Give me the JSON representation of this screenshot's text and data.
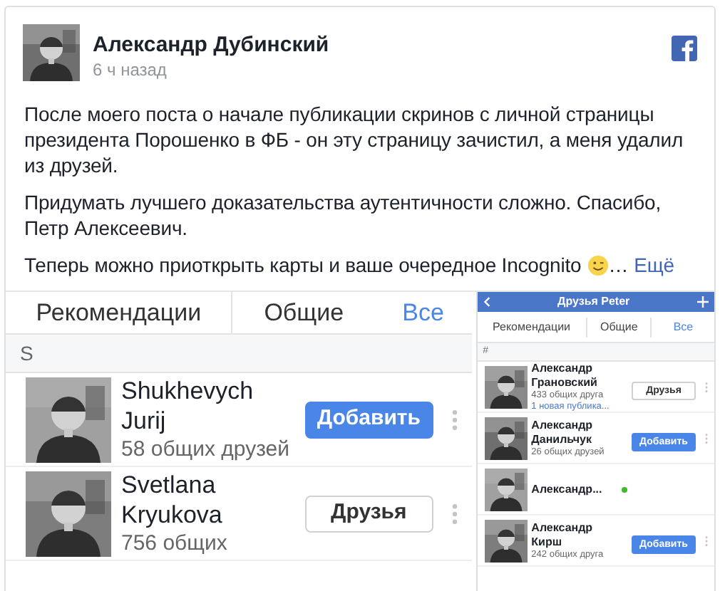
{
  "post": {
    "author": "Александр Дубинский",
    "time": "6 ч назад",
    "paragraphs": [
      "После моего поста о начале публикации скринов с личной страницы президента Порошенко в ФБ - он эту страницу зачистил, а меня удалил из друзей.",
      "Придумать лучшего доказательства аутентичности сложно. Спасибо, Петр Алексеевич."
    ],
    "last_paragraph": "Теперь можно приоткрыть карты и ваше очередное Incognito",
    "ellipsis": "…",
    "more_link": "Ещё"
  },
  "screenshots": [
    {
      "tabs": [
        {
          "label": "Рекомендации",
          "selected": false
        },
        {
          "label": "Общие",
          "selected": false
        },
        {
          "label": "Все",
          "selected": true
        }
      ],
      "section": "S",
      "people": [
        {
          "name": "Shukhevych Jurij",
          "mutual": "58 общих друзей",
          "button": {
            "kind": "add",
            "label": "Добавить"
          }
        },
        {
          "name": "Svetlana Kryukova",
          "mutual": "756 общих",
          "button": {
            "kind": "friends",
            "label": "Друзья"
          }
        }
      ]
    },
    {
      "title": "Друзья Peter",
      "tabs": [
        {
          "label": "Рекомендации",
          "selected": false
        },
        {
          "label": "Общие",
          "selected": false
        },
        {
          "label": "Все",
          "selected": true
        }
      ],
      "section": "#",
      "people": [
        {
          "name": "Александр Грановский",
          "mutual": "433 общих друга",
          "note": "1 новая публика...",
          "online": false,
          "button": {
            "kind": "friends",
            "label": "Друзья"
          }
        },
        {
          "name": "Александр Данильчук",
          "mutual": "26 общих друзей",
          "online": false,
          "button": {
            "kind": "add",
            "label": "Добавить"
          }
        },
        {
          "name": "Александр...",
          "online": true
        },
        {
          "name": "Александр Кирш",
          "mutual": "242 общих друга",
          "online": false,
          "button": {
            "kind": "add",
            "label": "Добавить"
          }
        }
      ]
    }
  ]
}
